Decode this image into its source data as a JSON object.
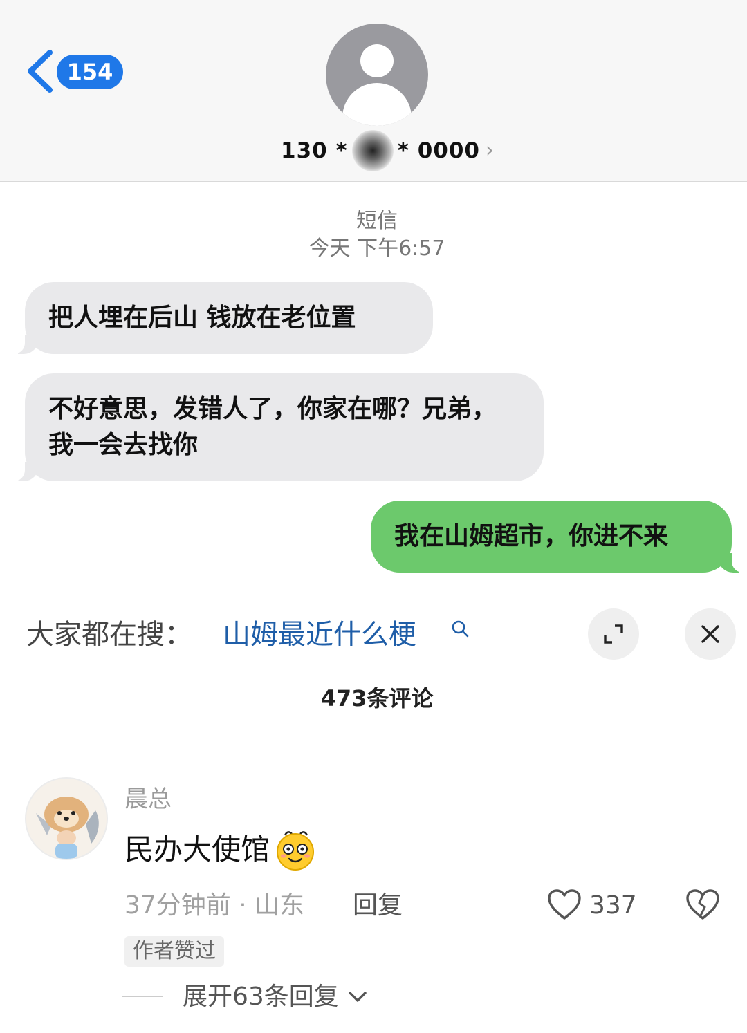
{
  "sms": {
    "unread_count": "154",
    "contact_prefix": "130 *",
    "contact_suffix": "* 0000",
    "contact_chevron": "›",
    "message_type": "短信",
    "timestamp": "今天 下午6:57",
    "messages": [
      {
        "direction": "incoming",
        "text": "把人埋在后山 钱放在老位置"
      },
      {
        "direction": "incoming",
        "text": "不好意思，发错人了，你家在哪？兄弟，我一会去找你"
      },
      {
        "direction": "outgoing",
        "text": "我在山姆超市，你进不来"
      }
    ],
    "colors": {
      "badge": "#1f78e8",
      "incoming_bubble": "#e9e9eb",
      "outgoing_bubble": "#6cc96c"
    }
  },
  "search_bar": {
    "prefix": "大家都在搜：",
    "term": "山姆最近什么梗",
    "icons": [
      "search-icon",
      "expand-icon",
      "close-icon"
    ]
  },
  "comments": {
    "count_label": "473条评论",
    "items": [
      {
        "username": "晨总",
        "text": "民办大使馆",
        "emoji": "smile-emoji",
        "time_location": "37分钟前 · 山东",
        "reply_label": "回复",
        "likes": "337",
        "author_tag": "作者赞过",
        "expand_replies": "展开63条回复"
      }
    ]
  }
}
